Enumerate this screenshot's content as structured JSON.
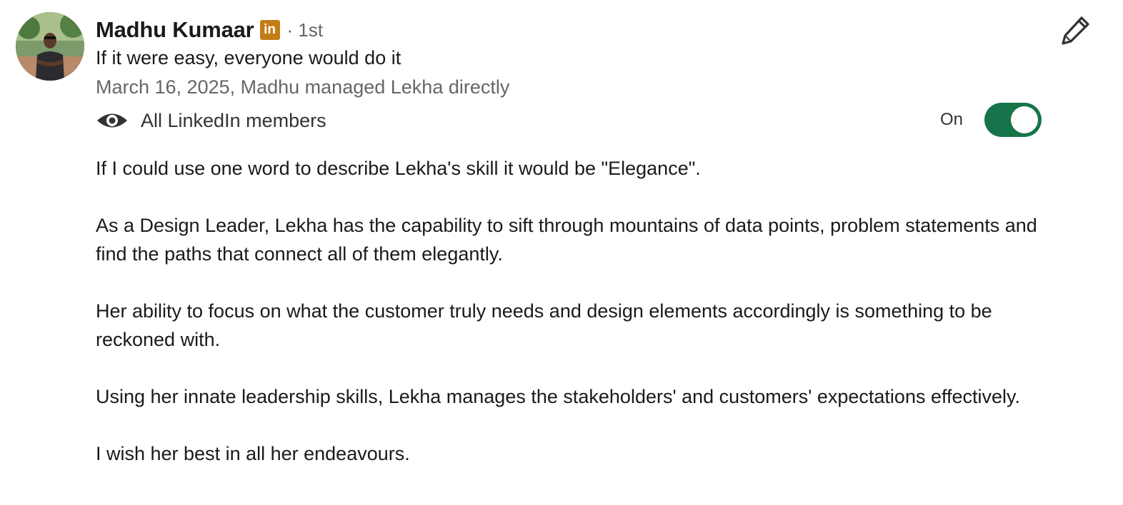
{
  "recommender": {
    "name": "Madhu Kumaar",
    "linkedin_badge": "in",
    "degree": "· 1st",
    "headline": "If it were easy, everyone would do it",
    "meta": "March 16, 2025, Madhu managed Lekha directly"
  },
  "visibility": {
    "icon": "eye-icon",
    "label": "All LinkedIn members",
    "toggle_state": "On",
    "toggle_on": true
  },
  "edit_icon": "pencil-icon",
  "recommendation": {
    "paragraphs": [
      "If I could use one word to describe Lekha's skill it would be \"Elegance\".",
      "As a Design Leader, Lekha has the capability to sift through mountains of data points, problem statements and find the paths that connect all of them elegantly.",
      "Her ability to focus on what the customer truly needs and design elements accordingly is something to be reckoned with.",
      "Using her innate leadership skills, Lekha manages the stakeholders' and customers' expectations effectively.",
      "I wish her best in all her endeavours."
    ]
  },
  "colors": {
    "toggle_on": "#17744a",
    "linkedin_badge": "#c37d16",
    "secondary_text": "#666666"
  }
}
